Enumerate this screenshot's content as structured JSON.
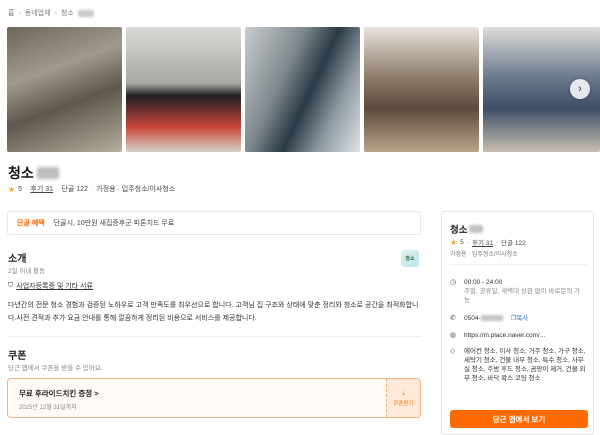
{
  "breadcrumb": {
    "home": "홈",
    "category": "동네업체",
    "current": "청소"
  },
  "gallery": {
    "photos": [
      "청소 현장 사진 1",
      "청소 현장 사진 2",
      "청소 현장 사진 3",
      "청소 현장 사진 4",
      "청소 현장 사진 5"
    ]
  },
  "business": {
    "name": "청소",
    "rating": "5",
    "reviews": "후기 31",
    "regulars": "단골 122",
    "category_line": "가정용 · 입주청소/이사청소",
    "category_1": "가정용",
    "category_2": "입주청소/이사청소"
  },
  "benefit": {
    "tag": "단골 혜택",
    "text": "단골시, 10만원 새집증후군 피톤치드 무료"
  },
  "intro": {
    "heading": "소개",
    "sub": "2일 이내 활동",
    "license_label": "사업자등록증 및 기타 서류",
    "description": "다년간의 전문 청소 경험과 검증된 노하우로 고객 만족도를 최우선으로 합니다. 고객님 집 구조와 상태에 맞춘 정리와 청소로 공간을 최적화합니다.사전 견적과 추가 요금 안내를 통해 깔끔하게 정리된 비용으로 서비스를 제공합니다."
  },
  "coupon": {
    "heading": "쿠폰",
    "sub": "당근 앱에서 쿠폰을 받을 수 있어요.",
    "name": "무료 후라이드치킨 증정",
    "chevron": ">",
    "date": "2025년 12월 31일까지",
    "button": "쿠폰받기"
  },
  "side": {
    "hours": "00:00 - 24:00",
    "hours_note": "주말, 공휴일, 새벽대 상관 없이 바로문의 가능",
    "phone": "0504-",
    "copy": "복사",
    "url": "https://m.place.naver.com/...",
    "services": "에어컨 청소, 이사 청소, 거주 청소, 가구 청소, 세탁기 청소, 건물 내부 청소, 특수 청소, 사무실 청소, 주방 후드 청소, 곰팡이 제거, 건물 외부 청소, 바닥 왁스 코팅 청소",
    "cta": "당근 앱에서 보기"
  },
  "icons": {
    "star": "star-icon",
    "clock": "clock-icon",
    "phone": "phone-icon",
    "globe": "globe-icon",
    "tag": "tag-icon",
    "download": "download-icon",
    "chevron": "chevron-right-icon",
    "shield": "shield-check-icon"
  },
  "colors": {
    "accent": "#ff6a00",
    "star": "#f5a623",
    "link": "#2f6fd6"
  }
}
